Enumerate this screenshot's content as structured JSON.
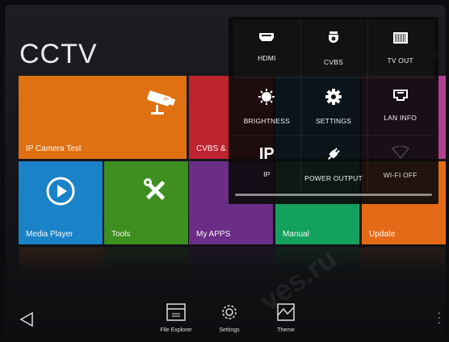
{
  "brand": {
    "title": "CCTV",
    "corner_text": "6"
  },
  "tiles": {
    "ip_camera": {
      "label": "IP Camera Test",
      "color": "#df7112"
    },
    "cvbs": {
      "label": "CVBS &",
      "color": "#bf2330"
    },
    "media_player": {
      "label": "Media Player",
      "color": "#1a82c6"
    },
    "tools": {
      "label": "Tools",
      "color": "#3e8f1f"
    },
    "my_apps": {
      "label": "My APPS",
      "color": "#6b2e86"
    },
    "manual": {
      "label": "Manual",
      "color": "#14a05d"
    },
    "update": {
      "label": "Update",
      "color": "#e56a17"
    }
  },
  "quick_panel": {
    "items": [
      {
        "label": "HDMI",
        "icon": "hdmi-icon"
      },
      {
        "label": "CVBS",
        "icon": "dome-camera-icon"
      },
      {
        "label": "TV OUT",
        "icon": "tv-out-icon"
      },
      {
        "label": "BRIGHTNESS",
        "icon": "brightness-icon"
      },
      {
        "label": "SETTINGS",
        "icon": "gear-icon"
      },
      {
        "label": "LAN INFO",
        "icon": "lan-port-icon"
      },
      {
        "label": "IP",
        "icon": "ip-text-icon"
      },
      {
        "label": "POWER OUTPUT",
        "icon": "power-plug-icon"
      },
      {
        "label": "WI-FI OFF",
        "icon": "wifi-off-icon"
      }
    ],
    "ip_glyph": "IP"
  },
  "dock": {
    "file_explorer": "File Explorer",
    "settings": "Settings",
    "theme": "Theme"
  }
}
